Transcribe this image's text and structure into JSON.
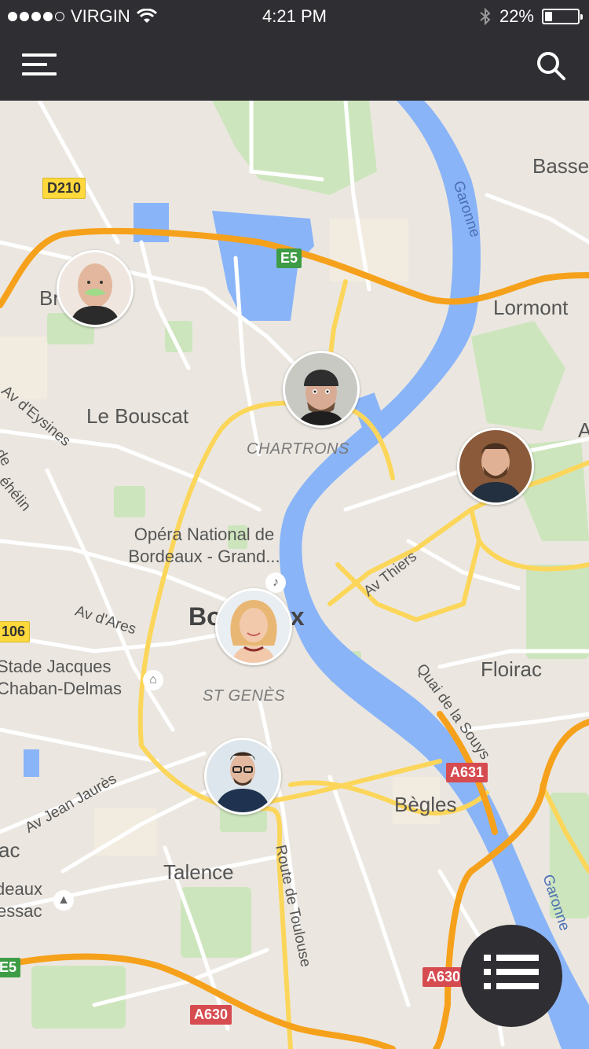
{
  "status_bar": {
    "carrier": "VIRGIN",
    "time": "4:21 PM",
    "battery_percent": "22%",
    "battery_level": 0.22,
    "signal_bars_filled": 4,
    "signal_bars_total": 5,
    "icons": [
      "wifi-icon",
      "bluetooth-icon",
      "battery-icon"
    ]
  },
  "nav": {
    "menu_icon": "hamburger-menu-icon",
    "search_icon": "search-icon"
  },
  "map": {
    "cities": [
      "Le Bouscat",
      "Bordeaux",
      "Lormont",
      "Floirac",
      "Bègles",
      "Talence",
      "Bassens"
    ],
    "districts": [
      "CHARTRONS",
      "ST GENÈS"
    ],
    "streets": [
      "Av Thiers",
      "Quai de la Souys",
      "Av d'Ares",
      "Av Jean Jaurès",
      "Route de Toulouse",
      "Av d'Eysines",
      "Garonne",
      "Garonne"
    ],
    "pois": {
      "opera": "Opéra National de Bordeaux - Grand...",
      "stade": "Stade Jacques Chaban-Delmas"
    },
    "road_shields": [
      "D210",
      "E5",
      "A631",
      "A630",
      "A630",
      "106",
      "E5"
    ],
    "edge_labels": [
      "Br",
      "ac",
      "deaux",
      "essac",
      "de",
      "éhélin",
      "A"
    ],
    "colors": {
      "land": "#ebe7e0",
      "water": "#8ab4f8",
      "highway": "#f6a11b",
      "major_road": "#fcd65a",
      "road": "#ffffff",
      "park": "#c9e2b8"
    }
  },
  "people": [
    {
      "name": "avatar-bald-man",
      "icon": "user-avatar"
    },
    {
      "name": "avatar-beanie-man",
      "icon": "user-avatar"
    },
    {
      "name": "avatar-bearded-man",
      "icon": "user-avatar"
    },
    {
      "name": "avatar-blonde-woman",
      "icon": "user-avatar"
    },
    {
      "name": "avatar-glasses-man",
      "icon": "user-avatar"
    }
  ],
  "fab": {
    "icon": "list-icon"
  }
}
